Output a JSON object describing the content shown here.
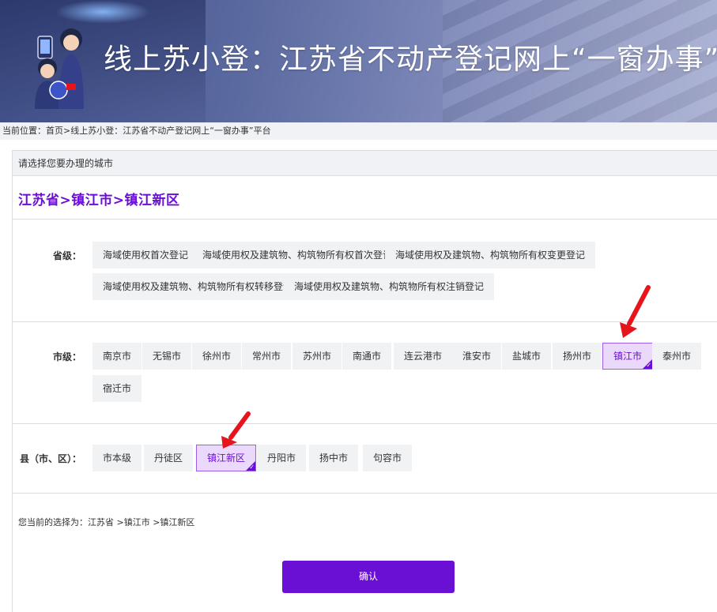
{
  "header": {
    "title": "线上苏小登：江苏省不动产登记网上“一窗办事”平台"
  },
  "breadcrumb": {
    "text": "当前位置：首页>线上苏小登：江苏省不动产登记网上“一窗办事”平台"
  },
  "panel": {
    "heading": "请选择您要办理的城市",
    "selected_path": "江苏省>镇江市>镇江新区"
  },
  "province": {
    "label": "省级：",
    "options": [
      "海域使用权首次登记",
      "海域使用权及建筑物、构筑物所有权首次登记",
      "海域使用权及建筑物、构筑物所有权变更登记",
      "海域使用权及建筑物、构筑物所有权转移登记",
      "海域使用权及建筑物、构筑物所有权注销登记"
    ]
  },
  "city": {
    "label": "市级：",
    "options": [
      "南京市",
      "无锡市",
      "徐州市",
      "常州市",
      "苏州市",
      "南通市",
      "连云港市",
      "淮安市",
      "盐城市",
      "扬州市",
      "镇江市",
      "泰州市",
      "宿迁市"
    ],
    "selected": "镇江市"
  },
  "county": {
    "label": "县（市、区）：",
    "options": [
      "市本级",
      "丹徒区",
      "镇江新区",
      "丹阳市",
      "扬中市",
      "句容市"
    ],
    "selected": "镇江新区"
  },
  "current_selection": "您当前的选择为：江苏省 >镇江市 >镇江新区",
  "confirm_label": "确认",
  "colors": {
    "accent": "#6a0fd4",
    "arrow": "#e8141c"
  }
}
